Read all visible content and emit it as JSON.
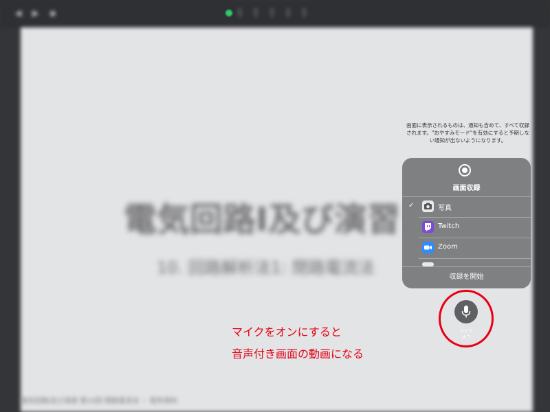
{
  "background": {
    "toolbar_left": "◀ ▶ ◆",
    "toolbar_center": "Ξ Ξ Ξ Ξ Ξ",
    "title": "電気回路I及び演習",
    "subtitle": "10. 回路解析法1: 閉路電流法",
    "footer": "電気回路I及び演習 第10回 閉路電流法 ・ 配布資料"
  },
  "notice": "画面に表示されるものは、通知も含めて、すべて収録されます。\"おやすみモード\"を有効にすると予期しない通知が出ないようになります。",
  "recording_panel": {
    "title": "画面収録",
    "options": [
      {
        "label": "写真",
        "selected": true,
        "icon": "photos-icon"
      },
      {
        "label": "Twitch",
        "selected": false,
        "icon": "twitch-icon"
      },
      {
        "label": "Zoom",
        "selected": false,
        "icon": "zoom-icon"
      }
    ],
    "checkmark": "✓",
    "start_label": "収録を開始"
  },
  "mic": {
    "label": "マイク",
    "state": "オフ"
  },
  "annotation": {
    "line1": "マイクをオンにすると",
    "line2": "音声付き画面の動画になる"
  },
  "colors": {
    "annotation": "#e60012",
    "panel": "#7f8082"
  }
}
